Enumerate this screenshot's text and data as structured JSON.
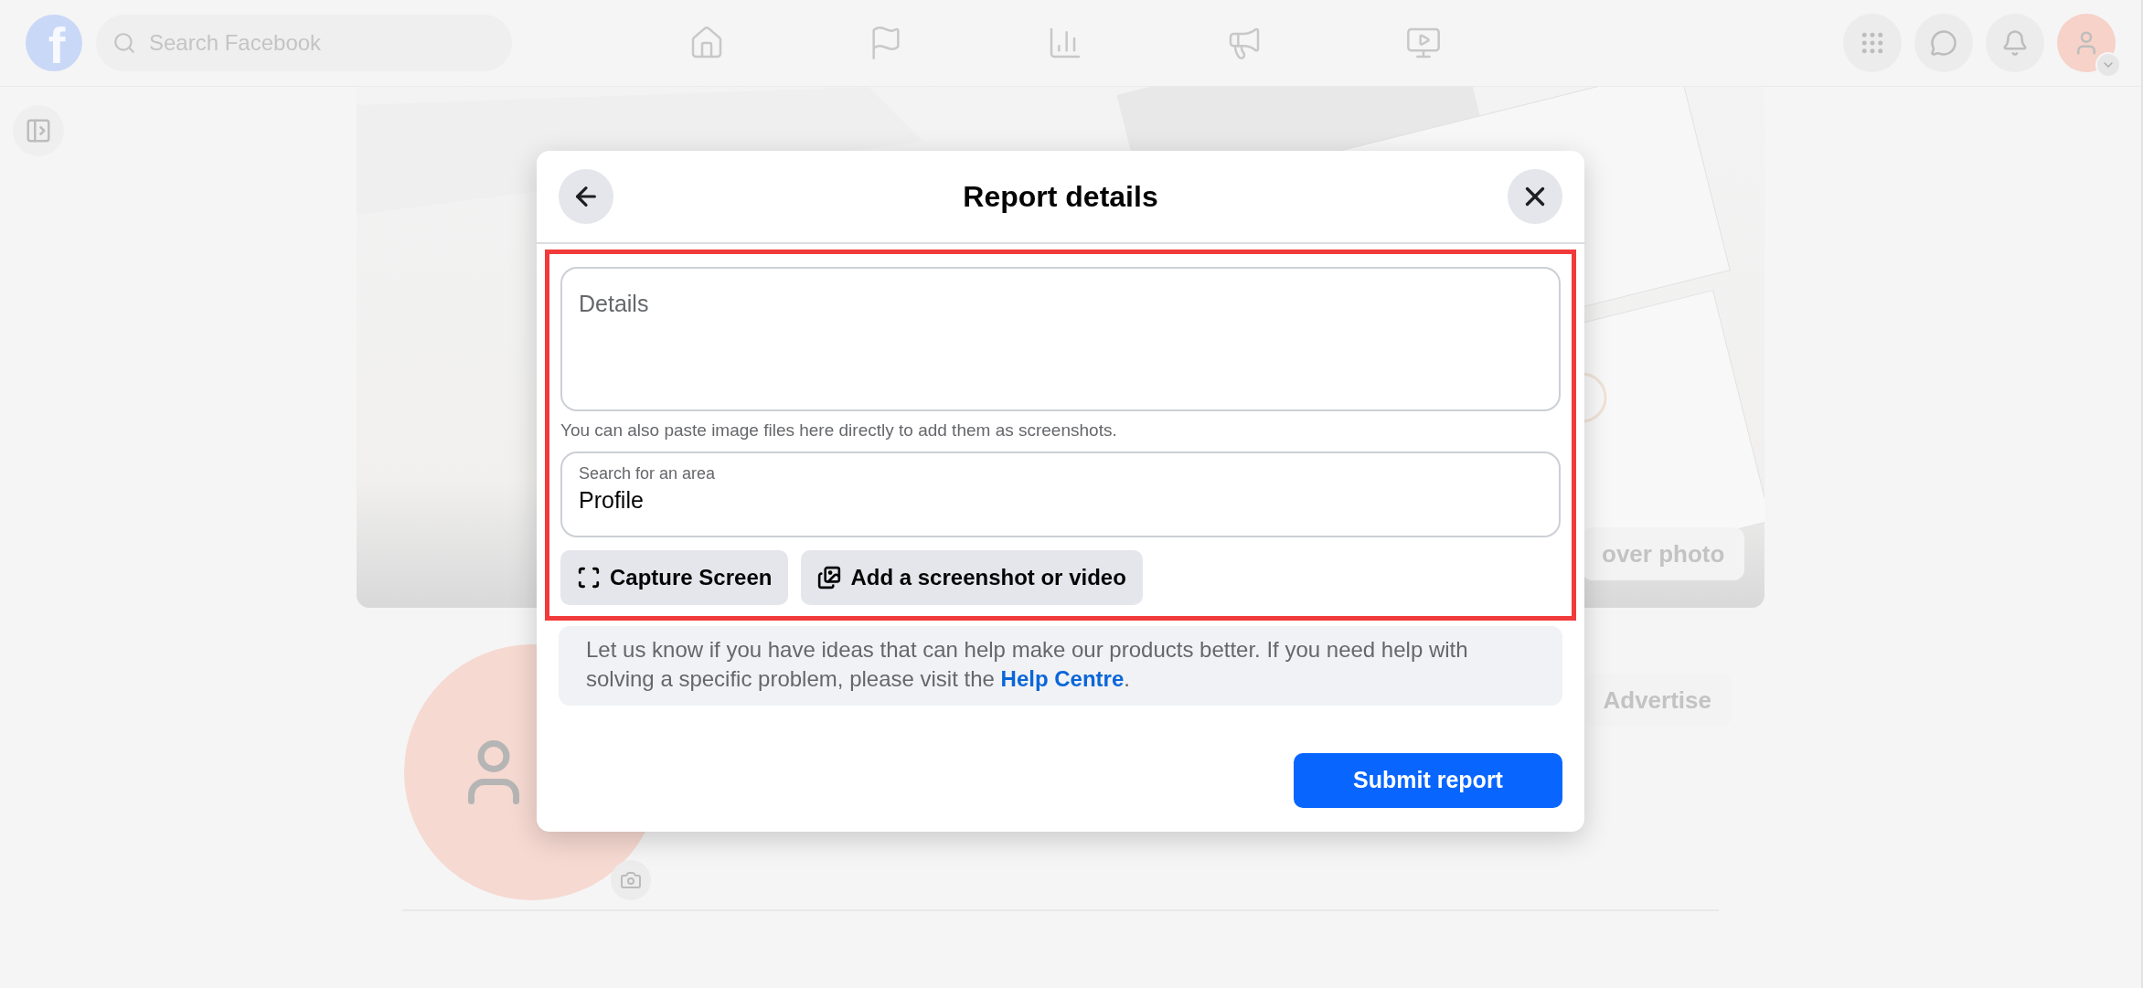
{
  "top_bar": {
    "logo": "f",
    "search": {
      "placeholder": "Search Facebook"
    }
  },
  "page": {
    "cover_button": "over photo",
    "profile_button": "Advertise"
  },
  "dialog": {
    "title": "Report details",
    "details": {
      "placeholder": "Details"
    },
    "hint": "You can also paste image files here directly to add them as screenshots.",
    "area_field": {
      "label": "Search for an area",
      "value": "Profile"
    },
    "actions": [
      {
        "kind": "capture",
        "label": "Capture Screen"
      },
      {
        "kind": "upload",
        "label": "Add a screenshot or video"
      }
    ],
    "notice": {
      "text": "Let us know if you have ideas that can help make our products better. If you need help with solving a specific problem, please visit the",
      "link": "Help Centre",
      "after": "."
    },
    "submit": "Submit report"
  }
}
